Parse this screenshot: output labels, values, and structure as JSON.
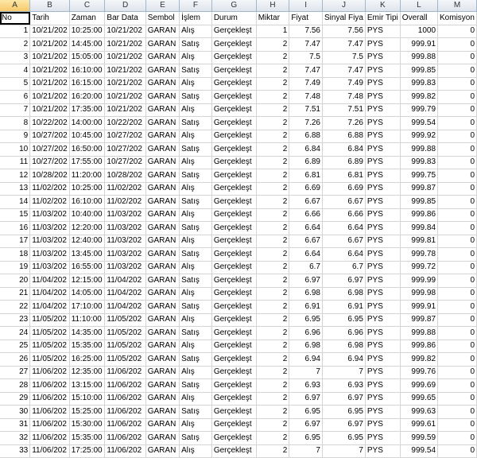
{
  "columns": [
    "A",
    "B",
    "C",
    "D",
    "E",
    "F",
    "G",
    "H",
    "I",
    "J",
    "K",
    "L",
    "M"
  ],
  "selected_column": "A",
  "headers": [
    "No",
    "Tarih",
    "Zaman",
    "Bar Data",
    "Sembol",
    "İşlem",
    "Durum",
    "Miktar",
    "Fiyat",
    "Sinyal Fiya",
    "Emir Tipi",
    "Overall",
    "Komisyon"
  ],
  "rows": [
    [
      "1",
      "10/21/202",
      "10:25:00",
      "10/21/202",
      "GARAN",
      "Alış",
      "Gerçekleşt",
      "1",
      "7.56",
      "7.56",
      "PYS",
      "1000",
      "0"
    ],
    [
      "2",
      "10/21/202",
      "14:45:00",
      "10/21/202",
      "GARAN",
      "Satış",
      "Gerçekleşt",
      "2",
      "7.47",
      "7.47",
      "PYS",
      "999.91",
      "0"
    ],
    [
      "3",
      "10/21/202",
      "15:05:00",
      "10/21/202",
      "GARAN",
      "Alış",
      "Gerçekleşt",
      "2",
      "7.5",
      "7.5",
      "PYS",
      "999.88",
      "0"
    ],
    [
      "4",
      "10/21/202",
      "16:10:00",
      "10/21/202",
      "GARAN",
      "Satış",
      "Gerçekleşt",
      "2",
      "7.47",
      "7.47",
      "PYS",
      "999.85",
      "0"
    ],
    [
      "5",
      "10/21/202",
      "16:15:00",
      "10/21/202",
      "GARAN",
      "Alış",
      "Gerçekleşt",
      "2",
      "7.49",
      "7.49",
      "PYS",
      "999.83",
      "0"
    ],
    [
      "6",
      "10/21/202",
      "16:20:00",
      "10/21/202",
      "GARAN",
      "Satış",
      "Gerçekleşt",
      "2",
      "7.48",
      "7.48",
      "PYS",
      "999.82",
      "0"
    ],
    [
      "7",
      "10/21/202",
      "17:35:00",
      "10/21/202",
      "GARAN",
      "Alış",
      "Gerçekleşt",
      "2",
      "7.51",
      "7.51",
      "PYS",
      "999.79",
      "0"
    ],
    [
      "8",
      "10/22/202",
      "14:00:00",
      "10/22/202",
      "GARAN",
      "Satış",
      "Gerçekleşt",
      "2",
      "7.26",
      "7.26",
      "PYS",
      "999.54",
      "0"
    ],
    [
      "9",
      "10/27/202",
      "10:45:00",
      "10/27/202",
      "GARAN",
      "Alış",
      "Gerçekleşt",
      "2",
      "6.88",
      "6.88",
      "PYS",
      "999.92",
      "0"
    ],
    [
      "10",
      "10/27/202",
      "16:50:00",
      "10/27/202",
      "GARAN",
      "Satış",
      "Gerçekleşt",
      "2",
      "6.84",
      "6.84",
      "PYS",
      "999.88",
      "0"
    ],
    [
      "11",
      "10/27/202",
      "17:55:00",
      "10/27/202",
      "GARAN",
      "Alış",
      "Gerçekleşt",
      "2",
      "6.89",
      "6.89",
      "PYS",
      "999.83",
      "0"
    ],
    [
      "12",
      "10/28/202",
      "11:20:00",
      "10/28/202",
      "GARAN",
      "Satış",
      "Gerçekleşt",
      "2",
      "6.81",
      "6.81",
      "PYS",
      "999.75",
      "0"
    ],
    [
      "13",
      "11/02/202",
      "10:25:00",
      "11/02/202",
      "GARAN",
      "Alış",
      "Gerçekleşt",
      "2",
      "6.69",
      "6.69",
      "PYS",
      "999.87",
      "0"
    ],
    [
      "14",
      "11/02/202",
      "16:10:00",
      "11/02/202",
      "GARAN",
      "Satış",
      "Gerçekleşt",
      "2",
      "6.67",
      "6.67",
      "PYS",
      "999.85",
      "0"
    ],
    [
      "15",
      "11/03/202",
      "10:40:00",
      "11/03/202",
      "GARAN",
      "Alış",
      "Gerçekleşt",
      "2",
      "6.66",
      "6.66",
      "PYS",
      "999.86",
      "0"
    ],
    [
      "16",
      "11/03/202",
      "12:20:00",
      "11/03/202",
      "GARAN",
      "Satış",
      "Gerçekleşt",
      "2",
      "6.64",
      "6.64",
      "PYS",
      "999.84",
      "0"
    ],
    [
      "17",
      "11/03/202",
      "12:40:00",
      "11/03/202",
      "GARAN",
      "Alış",
      "Gerçekleşt",
      "2",
      "6.67",
      "6.67",
      "PYS",
      "999.81",
      "0"
    ],
    [
      "18",
      "11/03/202",
      "13:45:00",
      "11/03/202",
      "GARAN",
      "Satış",
      "Gerçekleşt",
      "2",
      "6.64",
      "6.64",
      "PYS",
      "999.78",
      "0"
    ],
    [
      "19",
      "11/03/202",
      "16:55:00",
      "11/03/202",
      "GARAN",
      "Alış",
      "Gerçekleşt",
      "2",
      "6.7",
      "6.7",
      "PYS",
      "999.72",
      "0"
    ],
    [
      "20",
      "11/04/202",
      "12:15:00",
      "11/04/202",
      "GARAN",
      "Satış",
      "Gerçekleşt",
      "2",
      "6.97",
      "6.97",
      "PYS",
      "999.99",
      "0"
    ],
    [
      "21",
      "11/04/202",
      "14:05:00",
      "11/04/202",
      "GARAN",
      "Alış",
      "Gerçekleşt",
      "2",
      "6.98",
      "6.98",
      "PYS",
      "999.98",
      "0"
    ],
    [
      "22",
      "11/04/202",
      "17:10:00",
      "11/04/202",
      "GARAN",
      "Satış",
      "Gerçekleşt",
      "2",
      "6.91",
      "6.91",
      "PYS",
      "999.91",
      "0"
    ],
    [
      "23",
      "11/05/202",
      "11:10:00",
      "11/05/202",
      "GARAN",
      "Alış",
      "Gerçekleşt",
      "2",
      "6.95",
      "6.95",
      "PYS",
      "999.87",
      "0"
    ],
    [
      "24",
      "11/05/202",
      "14:35:00",
      "11/05/202",
      "GARAN",
      "Satış",
      "Gerçekleşt",
      "2",
      "6.96",
      "6.96",
      "PYS",
      "999.88",
      "0"
    ],
    [
      "25",
      "11/05/202",
      "15:35:00",
      "11/05/202",
      "GARAN",
      "Alış",
      "Gerçekleşt",
      "2",
      "6.98",
      "6.98",
      "PYS",
      "999.86",
      "0"
    ],
    [
      "26",
      "11/05/202",
      "16:25:00",
      "11/05/202",
      "GARAN",
      "Satış",
      "Gerçekleşt",
      "2",
      "6.94",
      "6.94",
      "PYS",
      "999.82",
      "0"
    ],
    [
      "27",
      "11/06/202",
      "12:35:00",
      "11/06/202",
      "GARAN",
      "Alış",
      "Gerçekleşt",
      "2",
      "7",
      "7",
      "PYS",
      "999.76",
      "0"
    ],
    [
      "28",
      "11/06/202",
      "13:15:00",
      "11/06/202",
      "GARAN",
      "Satış",
      "Gerçekleşt",
      "2",
      "6.93",
      "6.93",
      "PYS",
      "999.69",
      "0"
    ],
    [
      "29",
      "11/06/202",
      "15:10:00",
      "11/06/202",
      "GARAN",
      "Alış",
      "Gerçekleşt",
      "2",
      "6.97",
      "6.97",
      "PYS",
      "999.65",
      "0"
    ],
    [
      "30",
      "11/06/202",
      "15:25:00",
      "11/06/202",
      "GARAN",
      "Satış",
      "Gerçekleşt",
      "2",
      "6.95",
      "6.95",
      "PYS",
      "999.63",
      "0"
    ],
    [
      "31",
      "11/06/202",
      "15:30:00",
      "11/06/202",
      "GARAN",
      "Alış",
      "Gerçekleşt",
      "2",
      "6.97",
      "6.97",
      "PYS",
      "999.61",
      "0"
    ],
    [
      "32",
      "11/06/202",
      "15:35:00",
      "11/06/202",
      "GARAN",
      "Satış",
      "Gerçekleşt",
      "2",
      "6.95",
      "6.95",
      "PYS",
      "999.59",
      "0"
    ],
    [
      "33",
      "11/06/202",
      "17:25:00",
      "11/06/202",
      "GARAN",
      "Alış",
      "Gerçekleşt",
      "2",
      "7",
      "7",
      "PYS",
      "999.54",
      "0"
    ]
  ]
}
